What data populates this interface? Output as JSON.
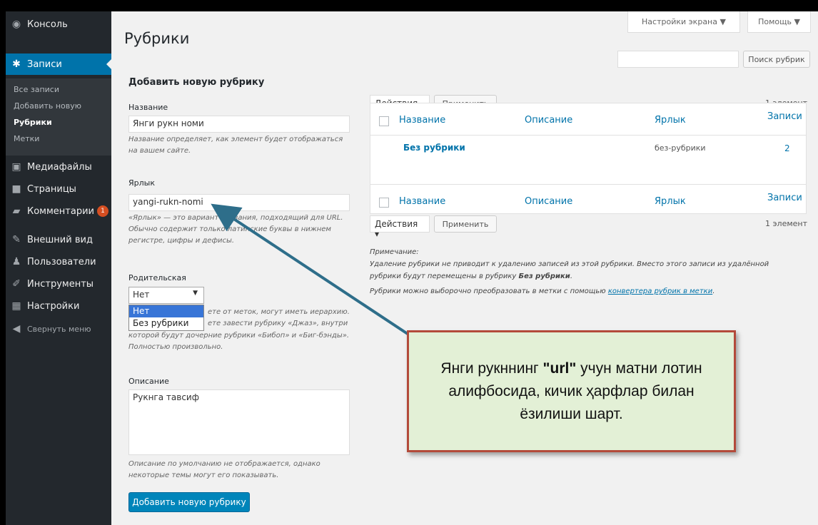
{
  "sidebar": {
    "items": [
      {
        "label": "Консоль",
        "icon": "dashboard-icon"
      },
      {
        "label": "Записи",
        "icon": "pin-icon"
      },
      {
        "label": "Медиафайлы",
        "icon": "media-icon"
      },
      {
        "label": "Страницы",
        "icon": "page-icon"
      },
      {
        "label": "Комментарии",
        "icon": "comment-icon",
        "badge": "1"
      },
      {
        "label": "Внешний вид",
        "icon": "brush-icon"
      },
      {
        "label": "Пользователи",
        "icon": "user-icon"
      },
      {
        "label": "Инструменты",
        "icon": "wrench-icon"
      },
      {
        "label": "Настройки",
        "icon": "settings-icon"
      },
      {
        "label": "Свернуть меню",
        "icon": "collapse-icon"
      }
    ],
    "submenu": [
      "Все записи",
      "Добавить новую",
      "Рубрики",
      "Метки"
    ]
  },
  "header": {
    "title": "Рубрики",
    "screen_options": "Настройки экрана ▼",
    "help": "Помощь ▼",
    "search_button": "Поиск рубрик",
    "search_value": ""
  },
  "form": {
    "heading": "Добавить новую рубрику",
    "name_label": "Название",
    "name_value": "Янги рукн номи",
    "name_help_1": "Название определяет, как элемент будет отображаться",
    "name_help_2": "на вашем сайте.",
    "slug_label": "Ярлык",
    "slug_value": "yangi-rukn-nomi",
    "slug_help_1": "«Ярлык» — это вариант названия, подходящий для URL.",
    "slug_help_2": "Обычно содержит только латинские буквы в нижнем",
    "slug_help_3": "регистре, цифры и дефисы.",
    "parent_label": "Родительская",
    "parent_value": "Нет",
    "parent_options": [
      "Нет",
      "Без рубрики"
    ],
    "parent_help_1": "ете от меток, могут иметь иерархию.",
    "parent_help_2": "ете завести рубрику «Джаз», внутри",
    "parent_help_3": "которой будут дочерние рубрики «Бибоп» и «Биг-бэнды».",
    "parent_help_4": "Полностью произвольно.",
    "desc_label": "Описание",
    "desc_value": "Рукнга тавсиф",
    "desc_help_1": "Описание по умолчанию не отображается, однако",
    "desc_help_2": "некоторые темы могут его показывать.",
    "submit": "Добавить новую рубрику"
  },
  "table": {
    "bulk_action": "Действия ▾",
    "apply": "Применить",
    "count": "1 элемент",
    "columns": [
      "Название",
      "Описание",
      "Ярлык",
      "Записи"
    ],
    "rows": [
      {
        "name": "Без рубрики",
        "description": "",
        "slug": "без-рубрики",
        "posts": "2"
      }
    ]
  },
  "note": {
    "title": "Примечание:",
    "line1": "Удаление рубрики не приводит к удалению записей из этой рубрики. Вместо этого записи из удалённой",
    "line2_pre": "рубрики будут перемещены в рубрику ",
    "line2_bold": "Без рубрики",
    "line2_post": ".",
    "line3_pre": "Рубрики можно выборочно преобразовать в метки с помощью ",
    "line3_link": "конвертера рубрик в метки",
    "line3_post": "."
  },
  "callout": {
    "pre": "Янги рукннинг ",
    "bold": "\"url\"",
    "post": " учун матни лотин алифбосида, кичик ҳарфлар билан ёзилиши шарт."
  },
  "colors": {
    "sidebar": "#23282d",
    "accent": "#0073aa",
    "primary_button": "#0085ba",
    "callout_bg": "#e3f0d6",
    "callout_border": "#b34a3a",
    "arrow": "#2e6e8a"
  }
}
